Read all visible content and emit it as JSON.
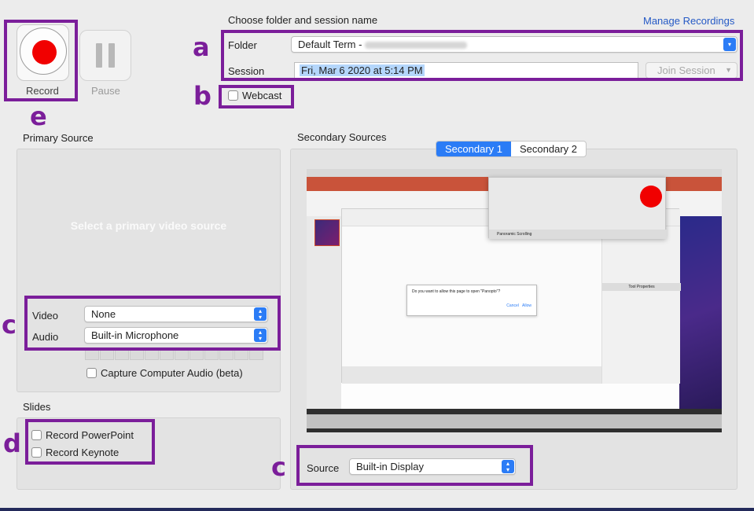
{
  "header": {
    "choose_label": "Choose folder and session name",
    "manage_link": "Manage Recordings"
  },
  "controls": {
    "record_label": "Record",
    "pause_label": "Pause"
  },
  "folder": {
    "label": "Folder",
    "value": "Default Term - "
  },
  "session": {
    "label": "Session",
    "value": "Fri, Mar 6 2020 at 5:14 PM",
    "join_button": "Join Session"
  },
  "webcast": {
    "label": "Webcast",
    "checked": false
  },
  "primary": {
    "title": "Primary Source",
    "placeholder": "Select a primary video source",
    "video_label": "Video",
    "video_value": "None",
    "audio_label": "Audio",
    "audio_value": "Built-in Microphone",
    "capture_audio_label": "Capture Computer Audio (beta)"
  },
  "slides": {
    "title": "Slides",
    "powerpoint_label": "Record PowerPoint",
    "keynote_label": "Record Keynote"
  },
  "secondary": {
    "title": "Secondary Sources",
    "tabs": [
      "Secondary 1",
      "Secondary 2"
    ],
    "active_tab": 0,
    "source_label": "Source",
    "source_value": "Built-in Display"
  },
  "preview": {
    "ppt_dialog_text": "Do you want to allow this page to open \"Panopto\"?",
    "ppt_dialog_cancel": "Cancel",
    "ppt_dialog_allow": "Allow",
    "tool_panel_title": "Tool Properties",
    "dock_label": "Panoramic Scrolling"
  },
  "callouts": {
    "a": "a",
    "b": "b",
    "c1": "c",
    "c2": "c",
    "d": "d",
    "e": "e"
  },
  "colors": {
    "annotation_purple": "#7b1e9a",
    "accent_blue": "#2b7cf6",
    "record_red": "#f10000"
  }
}
